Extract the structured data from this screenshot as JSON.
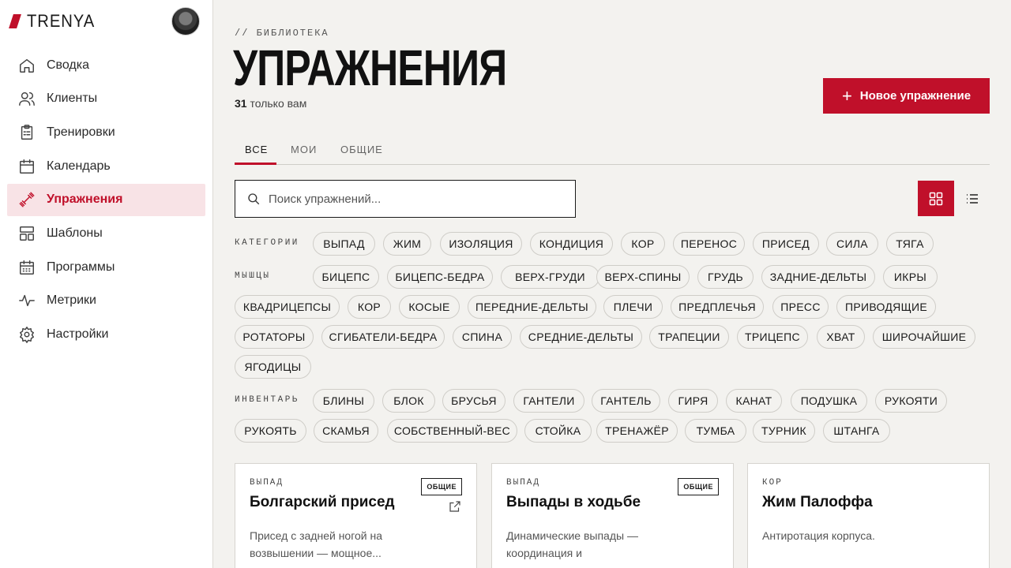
{
  "brand": {
    "name": "TRENYA",
    "accent": "#c0102a"
  },
  "nav": [
    {
      "label": "Сводка",
      "icon": "home-icon"
    },
    {
      "label": "Клиенты",
      "icon": "users-icon"
    },
    {
      "label": "Тренировки",
      "icon": "clipboard-icon"
    },
    {
      "label": "Календарь",
      "icon": "calendar-icon"
    },
    {
      "label": "Упражнения",
      "icon": "dumbbell-icon",
      "active": true
    },
    {
      "label": "Шаблоны",
      "icon": "templates-icon"
    },
    {
      "label": "Программы",
      "icon": "program-calendar-icon"
    },
    {
      "label": "Метрики",
      "icon": "pulse-icon"
    },
    {
      "label": "Настройки",
      "icon": "gear-icon"
    }
  ],
  "header": {
    "crumb": "// БИБЛИОТЕКА",
    "title": "УПРАЖНЕНИЯ",
    "count": "31",
    "count_suffix": "только вам",
    "new_button": "Новое упражнение"
  },
  "tabs": [
    "ВСЕ",
    "МОИ",
    "ОБЩИЕ"
  ],
  "search": {
    "placeholder": "Поиск упражнений..."
  },
  "filters": {
    "categories_label": "КАТЕГОРИИ",
    "categories": [
      "ВЫПАД",
      "ЖИМ",
      "ИЗОЛЯЦИЯ",
      "КОНДИЦИЯ",
      "КОР",
      "ПЕРЕНОС",
      "ПРИСЕД",
      "СИЛА",
      "ТЯГА"
    ],
    "muscles_label": "МЫШЦЫ",
    "muscles": [
      "БИЦЕПС",
      "БИЦЕПС-БЕДРА",
      "ВЕРХ-ГРУДИ",
      "ВЕРХ-СПИНЫ",
      "ГРУДЬ",
      "ЗАДНИЕ-ДЕЛЬТЫ",
      "ИКРЫ",
      "КВАДРИЦЕПСЫ",
      "КОР",
      "КОСЫЕ",
      "ПЕРЕДНИЕ-ДЕЛЬТЫ",
      "ПЛЕЧИ",
      "ПРЕДПЛЕЧЬЯ",
      "ПРЕСС",
      "ПРИВОДЯЩИЕ",
      "РОТАТОРЫ",
      "СГИБАТЕЛИ-БЕДРА",
      "СПИНА",
      "СРЕДНИЕ-ДЕЛЬТЫ",
      "ТРАПЕЦИИ",
      "ТРИЦЕПС",
      "ХВАТ",
      "ШИРОЧАЙШИЕ",
      "ЯГОДИЦЫ"
    ],
    "equipment_label": "ИНВЕНТАРЬ",
    "equipment": [
      "БЛИНЫ",
      "БЛОК",
      "БРУСЬЯ",
      "ГАНТЕЛИ",
      "ГАНТЕЛЬ",
      "ГИРЯ",
      "КАНАТ",
      "ПОДУШКА",
      "РУКОЯТИ",
      "РУКОЯТЬ",
      "СКАМЬЯ",
      "СОБСТВЕННЫЙ-ВЕС",
      "СТОЙКА",
      "ТРЕНАЖЁР",
      "ТУМБА",
      "ТУРНИК",
      "ШТАНГА"
    ]
  },
  "cards": [
    {
      "category": "ВЫПАД",
      "name": "Болгарский присед",
      "badge": "ОБЩИЕ",
      "desc": "Присед с задней ногой на возвышении — мощное..."
    },
    {
      "category": "ВЫПАД",
      "name": "Выпады в ходьбе",
      "badge": "ОБЩИЕ",
      "desc": "Динамические выпады — координация и унилатеральная..."
    },
    {
      "category": "КОР",
      "name": "Жим Палоффа",
      "badge": "",
      "desc": "Антиротация корпуса."
    }
  ]
}
